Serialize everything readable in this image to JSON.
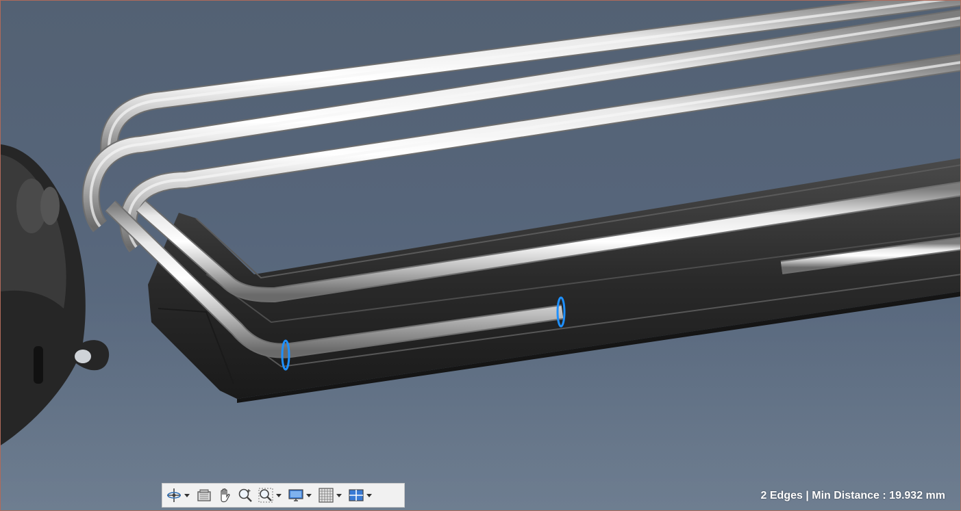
{
  "status": {
    "edge_info": "2 Edges | Min Distance : 19.932 mm"
  },
  "toolbar": {
    "tools": [
      {
        "name": "orbit",
        "icon": "orbit-icon",
        "has_dropdown": true
      },
      {
        "name": "look-at",
        "icon": "look-at-icon",
        "has_dropdown": false
      },
      {
        "name": "pan",
        "icon": "hand-pan-icon",
        "has_dropdown": false
      },
      {
        "name": "zoom",
        "icon": "zoom-icon",
        "has_dropdown": false
      },
      {
        "name": "fit",
        "icon": "zoom-window-icon",
        "has_dropdown": true
      },
      {
        "name": "display-settings",
        "icon": "monitor-icon",
        "has_dropdown": true
      },
      {
        "name": "grid-snaps",
        "icon": "grid-icon",
        "has_dropdown": true
      },
      {
        "name": "viewports",
        "icon": "viewports-icon",
        "has_dropdown": true
      }
    ]
  },
  "colors": {
    "background_top": "#536173",
    "background_bottom": "#627387",
    "tube": "#c8c8c8",
    "bracket": "#2b2b2b",
    "selection": "#1e90ff"
  }
}
